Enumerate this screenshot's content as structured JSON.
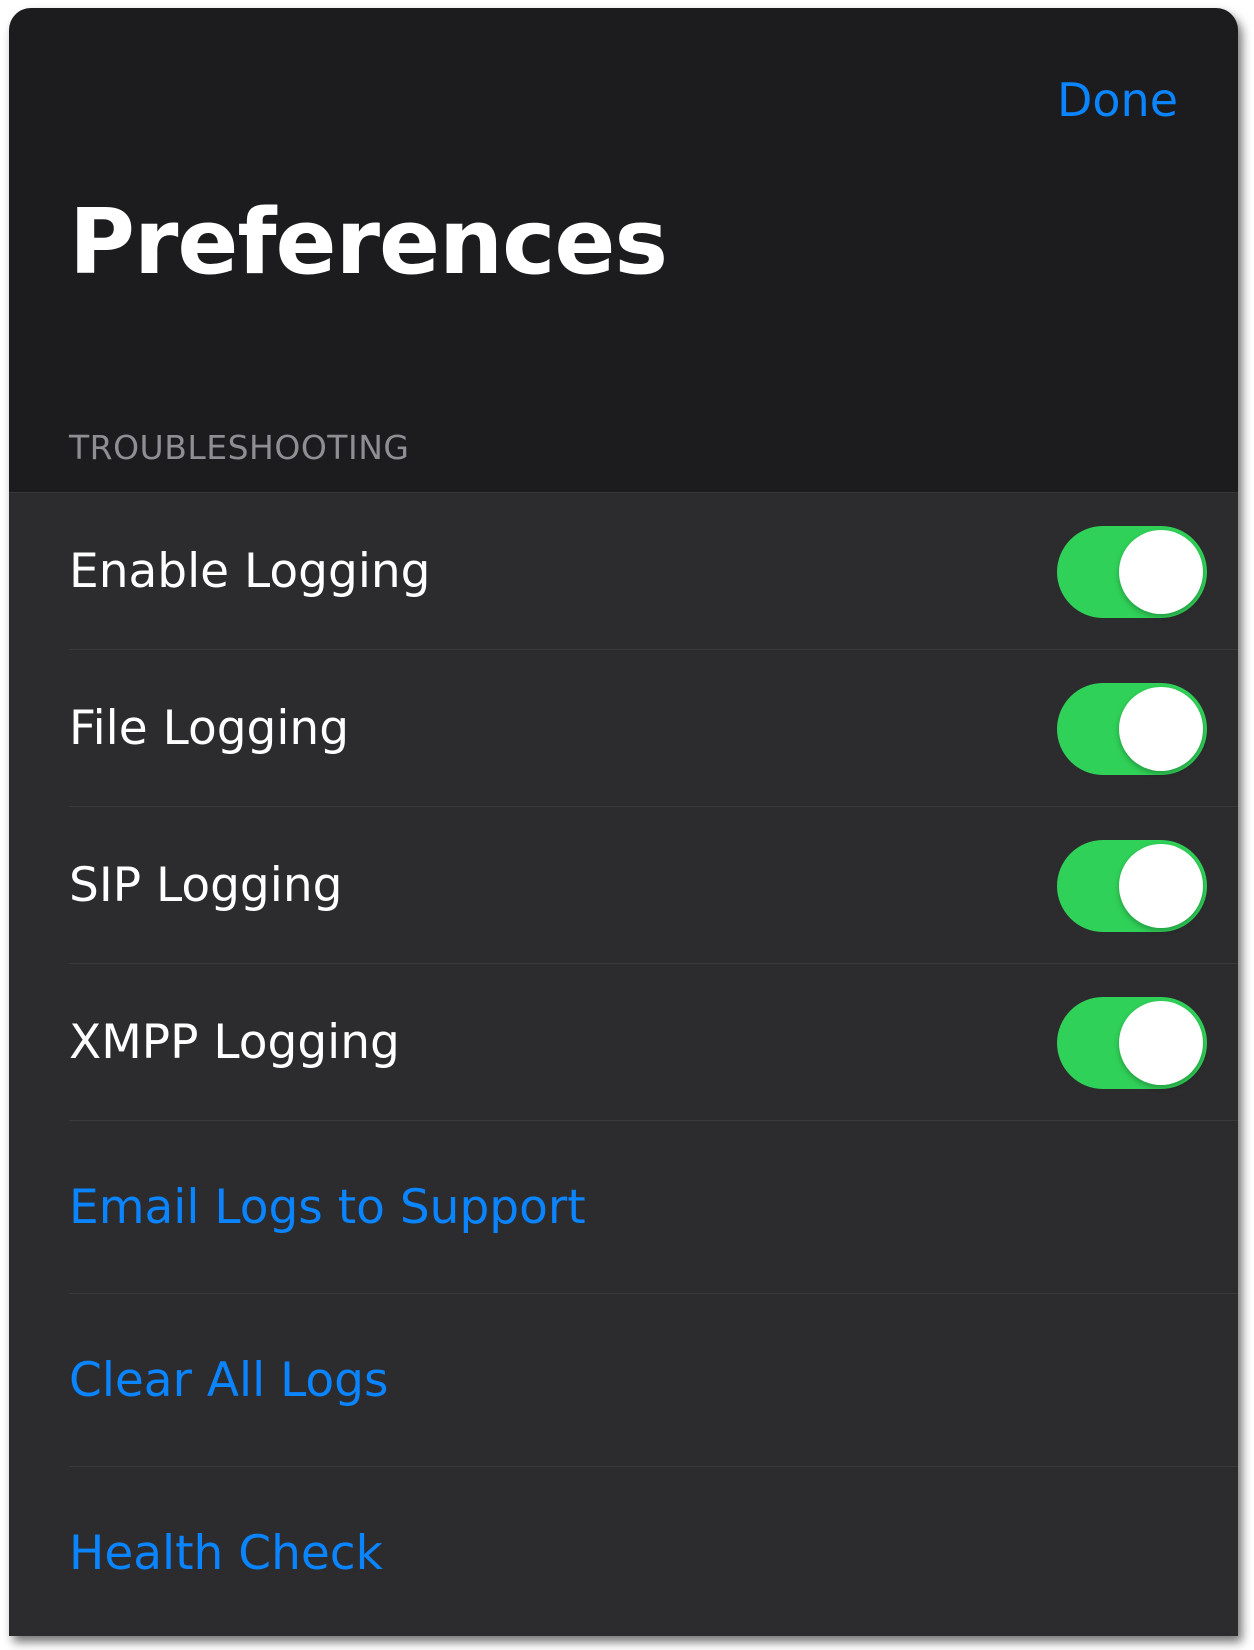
{
  "header": {
    "done_label": "Done",
    "title": "Preferences"
  },
  "section": {
    "header": "TROUBLESHOOTING"
  },
  "toggles": [
    {
      "label": "Enable Logging",
      "on": true
    },
    {
      "label": "File Logging",
      "on": true
    },
    {
      "label": "SIP Logging",
      "on": true
    },
    {
      "label": "XMPP Logging",
      "on": true
    }
  ],
  "actions": [
    {
      "label": "Email Logs to Support"
    },
    {
      "label": "Clear All Logs"
    },
    {
      "label": "Health Check"
    }
  ],
  "colors": {
    "accent": "#0a84ff",
    "toggle_on": "#30d158",
    "background": "#1c1c1e",
    "group_background": "#2c2c2e",
    "section_header": "#8e8e93"
  }
}
